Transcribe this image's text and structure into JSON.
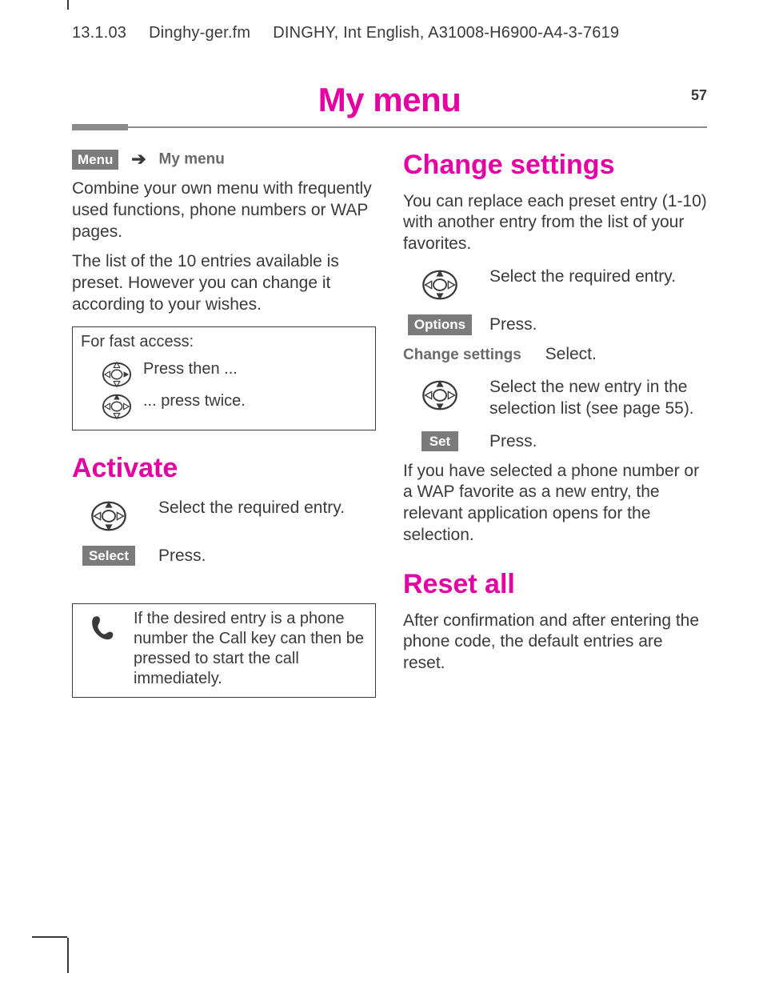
{
  "header": {
    "date": "13.1.03",
    "file": "Dinghy-ger.fm",
    "doc": "DINGHY, Int English, A31008-H6900-A4-3-7619"
  },
  "title": "My menu",
  "page_number": "57",
  "breadcrumb": {
    "menu": "Menu",
    "target": "My menu"
  },
  "left": {
    "intro1": "Combine your own menu with frequently used functions, phone numbers or WAP pages.",
    "intro2": "The list of the 10 entries available is preset. However you can change it according to your wishes.",
    "fastbox": {
      "title": "For fast access:",
      "step1": "Press then ...",
      "step2": "... press twice."
    },
    "activate": {
      "heading": "Activate",
      "step1": "Select the required entry.",
      "select_key": "Select",
      "step2": "Press."
    },
    "callnote": "If the desired entry is a phone number the Call key can then be pressed to start the call immediately."
  },
  "right": {
    "change": {
      "heading": "Change settings",
      "intro": "You can replace each preset entry (1-10) with another entry from the list of your favorites.",
      "step1": "Select the required entry.",
      "options_key": "Options",
      "step2": "Press.",
      "label": "Change settings",
      "step3": "Select.",
      "step4": "Select the new entry in the selection list (see page 55).",
      "set_key": "Set",
      "step5": "Press.",
      "outro": "If you have selected a phone number or a WAP favorite as a new entry, the relevant application opens for the selection."
    },
    "reset": {
      "heading": "Reset all",
      "body": "After confirmation and after entering the phone code, the default entries are reset."
    }
  },
  "icons": {
    "nav_right": "nav-right-icon",
    "nav_updown": "nav-updown-icon",
    "phone": "phone-icon",
    "arrow": "arrow-right-icon"
  }
}
